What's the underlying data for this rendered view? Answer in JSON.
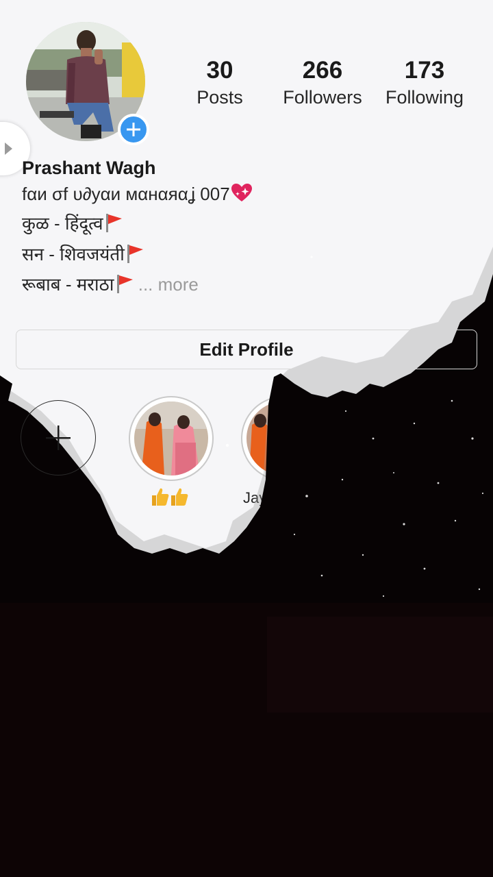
{
  "profile": {
    "name": "Prashant Wagh",
    "bio_lines": [
      "fαи σf υ∂уαи мαнαяαʝ 007",
      "कुळ - हिंदूत्व",
      "सन - शिवजयंती",
      "रूबाब - मराठा"
    ],
    "more_label": "... more"
  },
  "stats": [
    {
      "value": "30",
      "label": "Posts"
    },
    {
      "value": "266",
      "label": "Followers"
    },
    {
      "value": "173",
      "label": "Following"
    }
  ],
  "edit_profile_label": "Edit Profile",
  "highlights": [
    {
      "label": "👍👍"
    },
    {
      "label": "Jay"
    }
  ],
  "icons": {
    "add_story": "plus-badge-icon",
    "side_handle": "play-arrow-icon",
    "flag": "red-flag-emoji",
    "heart": "sparkling-heart-emoji"
  },
  "colors": {
    "accent": "#3897f0",
    "background": "#f6f6f8",
    "overlay_dark": "#070304",
    "flag_red": "#e8342a"
  }
}
